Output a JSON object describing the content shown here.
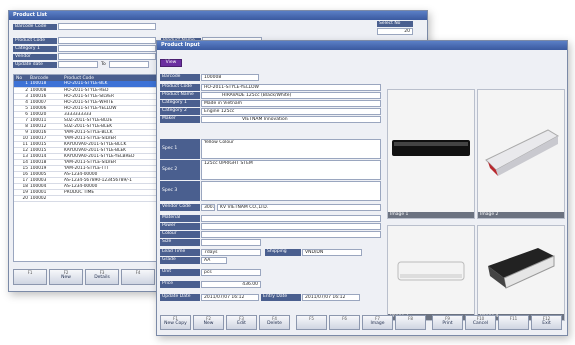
{
  "back": {
    "title": "Product List",
    "barcode_label": "Barcode Code",
    "filters": [
      {
        "label": "Product Code"
      },
      {
        "label": "Category 1"
      },
      {
        "label": "Vendor"
      },
      {
        "label": "Update date"
      }
    ],
    "product_name_label": "Product Name",
    "date_to": "To",
    "select_box": {
      "label": "Select No",
      "value": "20"
    },
    "columns": [
      "No",
      "Barcode",
      "Product Code"
    ],
    "rows": [
      {
        "no": "1",
        "barcode": "100018",
        "code": "HO-2011-STYLE-BLK",
        "sel": true
      },
      {
        "no": "2",
        "barcode": "100008",
        "code": "HO-2011-STYLE-RED"
      },
      {
        "no": "3",
        "barcode": "100016",
        "code": "HO-2011-STYLE-SILVER"
      },
      {
        "no": "4",
        "barcode": "100007",
        "code": "HO-2011-STYLE-WHITE"
      },
      {
        "no": "5",
        "barcode": "100006",
        "code": "HO-2011-STYLE-YELLOW"
      },
      {
        "no": "6",
        "barcode": "100020",
        "code": "3333333333"
      },
      {
        "no": "7",
        "barcode": "100011",
        "code": "SUZ-2011-STYLE-BLUE"
      },
      {
        "no": "8",
        "barcode": "100012",
        "code": "SUZ-2011-STYLE-BLEK"
      },
      {
        "no": "9",
        "barcode": "100016",
        "code": "YAM-2011-STYLE-BLCK"
      },
      {
        "no": "10",
        "barcode": "100017",
        "code": "YAM-2011-STYLE-SILVER"
      },
      {
        "no": "11",
        "barcode": "100015",
        "code": "KAYOUVA0-2011-STYLE-BLCK"
      },
      {
        "no": "12",
        "barcode": "100015",
        "code": "KAYOUVA0-2011-STYLE-BLEK"
      },
      {
        "no": "13",
        "barcode": "100014",
        "code": "KAYOUVA0-2011-STYLE-YELBRED"
      },
      {
        "no": "14",
        "barcode": "100018",
        "code": "YAM-2011-STYLE-SILVER"
      },
      {
        "no": "15",
        "barcode": "100019",
        "code": "YAM-2011-STYLE-TTT"
      },
      {
        "no": "16",
        "barcode": "100005",
        "code": "AS-1234-00000"
      },
      {
        "no": "17",
        "barcode": "100003",
        "code": "AS-1234-567890-123456789/-1"
      },
      {
        "no": "18",
        "barcode": "100004",
        "code": "AS-1234-00000"
      },
      {
        "no": "19",
        "barcode": "100001",
        "code": "PRODUC TIME"
      },
      {
        "no": "20",
        "barcode": "100002",
        "code": ""
      }
    ],
    "buttons": [
      {
        "key": "F1",
        "label": ""
      },
      {
        "key": "F2",
        "label": "New"
      },
      {
        "key": "F3",
        "label": "Details"
      },
      {
        "key": "F4",
        "label": ""
      }
    ]
  },
  "front": {
    "title": "Product Input",
    "view_button": "View",
    "fields": {
      "barcode": {
        "label": "Barcode",
        "value": "100008"
      },
      "product_code": {
        "label": "Product Code",
        "value": "HO-2011-STYLE-YELLOW"
      },
      "product_name": {
        "label": "Product Name",
        "value": "HIRAVADE 125cc (Black/White)"
      },
      "category1": {
        "label": "Category 1",
        "value": "Made in Vietnam"
      },
      "category2": {
        "label": "Category 2",
        "value": "Engine 125cc"
      },
      "maker": {
        "label": "Maker",
        "value": "VIETNAM Innovation"
      }
    },
    "specs": [
      {
        "label": "Spec 1",
        "value": "Yellow Colour"
      },
      {
        "label": "Spec 2",
        "value": "125cc UPRIGHT STEM"
      },
      {
        "label": "Spec 3",
        "value": ""
      }
    ],
    "vendor": {
      "label": "Vendor Code",
      "code": "3001",
      "name": "KV VIETNAM CO.,LTD."
    },
    "lower_labels": [
      "Material",
      "Power",
      "Colour",
      "Size"
    ],
    "lead_time": {
      "label": "Lead Time",
      "value": "7days"
    },
    "shipping": {
      "label": "Shipping",
      "value": "VND/DN"
    },
    "grade": {
      "label": "Grade",
      "value": "AA"
    },
    "unit": {
      "label": "Unit",
      "value": "pcs"
    },
    "price": {
      "label": "Price",
      "value": "436.00"
    },
    "update_date": {
      "label": "Update Date",
      "value": "2011/07/07 16:12"
    },
    "entry_date": {
      "label": "Entry Date",
      "value": "2011/07/07 16:12"
    },
    "images": [
      {
        "caption": "Image 1"
      },
      {
        "caption": "Image 2"
      },
      {
        "caption": "Image 3"
      },
      {
        "caption": "Image 4"
      }
    ],
    "buttons": [
      {
        "key": "F1",
        "label": "New Copy"
      },
      {
        "key": "F2",
        "label": "New"
      },
      {
        "key": "F3",
        "label": "Edit"
      },
      {
        "key": "F4",
        "label": "Delete"
      },
      {
        "key": "F5",
        "label": ""
      },
      {
        "key": "F6",
        "label": ""
      },
      {
        "key": "F7",
        "label": "Image"
      },
      {
        "key": "F8",
        "label": ""
      },
      {
        "key": "F9",
        "label": "Print"
      },
      {
        "key": "F10",
        "label": "Cancel"
      },
      {
        "key": "F11",
        "label": ""
      },
      {
        "key": "F12",
        "label": "Exit"
      }
    ]
  }
}
